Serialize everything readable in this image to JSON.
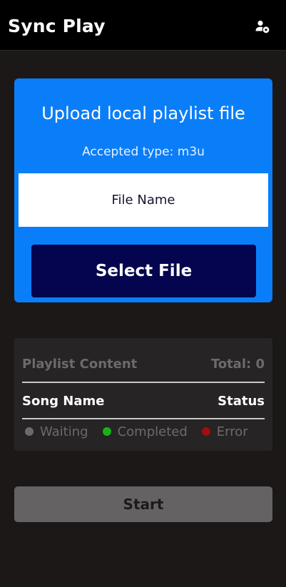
{
  "header": {
    "title": "Sync Play",
    "account_icon": "user-settings-icon"
  },
  "upload": {
    "heading": "Upload local playlist file",
    "accepted": "Accepted type: m3u",
    "file_name": "File Name",
    "select_button": "Select File"
  },
  "playlist": {
    "title": "Playlist Content",
    "total": "Total: 0",
    "col_song": "Song Name",
    "col_status": "Status",
    "legend": [
      {
        "label": "Waiting",
        "color": "#6b6b6b"
      },
      {
        "label": "Completed",
        "color": "#19b119"
      },
      {
        "label": "Error",
        "color": "#a30d0d"
      }
    ]
  },
  "start_button": "Start",
  "colors": {
    "header_bg": "#000000",
    "page_bg": "#1c1818",
    "card_blue": "#0a7ef8",
    "select_btn": "#04044f",
    "panel_bg": "#262424",
    "start_btn": "#646262"
  }
}
